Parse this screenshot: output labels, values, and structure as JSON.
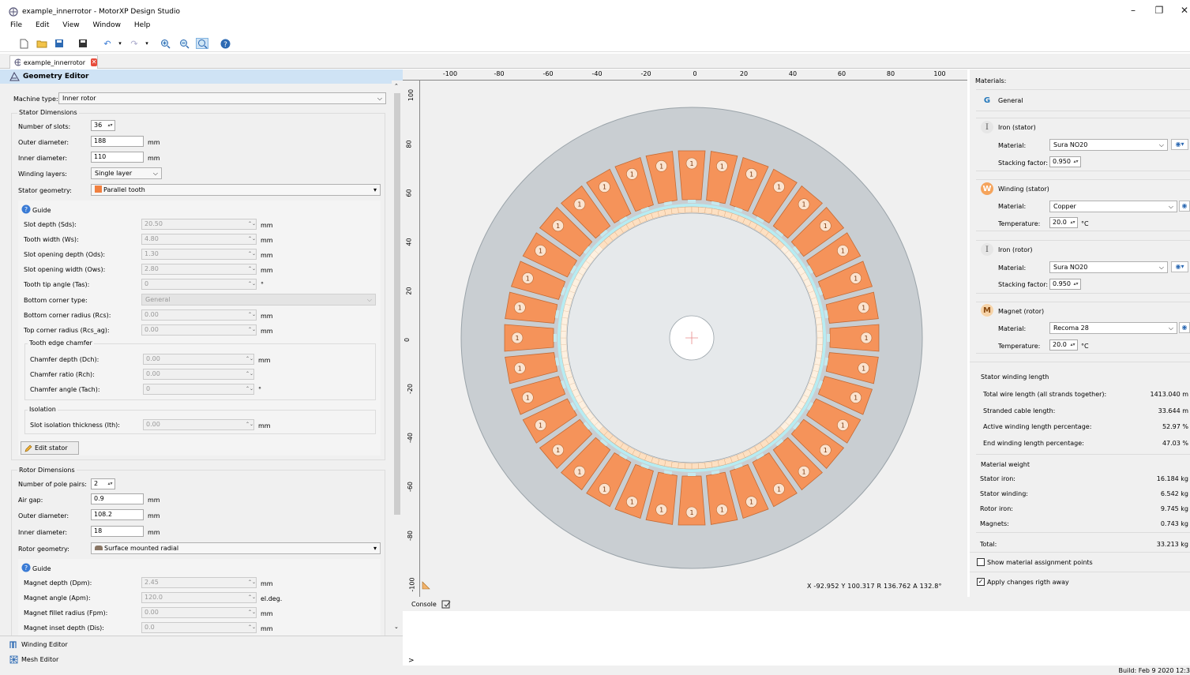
{
  "window": {
    "title": "example_innerrotor - MotorXP Design Studio"
  },
  "menu": [
    "File",
    "Edit",
    "View",
    "Window",
    "Help"
  ],
  "tab": {
    "label": "example_innerrotor"
  },
  "geometry_editor": {
    "header": "Geometry Editor",
    "machine_type_label": "Machine type:",
    "machine_type": "Inner rotor",
    "stator_dims_title": "Stator Dimensions",
    "stator": [
      {
        "label": "Number of slots:",
        "value": "36",
        "unit": ""
      },
      {
        "label": "Outer diameter:",
        "value": "188",
        "unit": "mm"
      },
      {
        "label": "Inner diameter:",
        "value": "110",
        "unit": "mm"
      }
    ],
    "winding_layers_label": "Winding layers:",
    "winding_layers": "Single layer",
    "stator_geometry_label": "Stator geometry:",
    "stator_geometry": "Parallel tooth",
    "guide": "Guide",
    "stator_params": [
      {
        "label": "Slot depth (Sds):",
        "value": "20.50",
        "unit": "mm"
      },
      {
        "label": "Tooth width (Ws):",
        "value": "4.80",
        "unit": "mm"
      },
      {
        "label": "Slot opening depth (Ods):",
        "value": "1.30",
        "unit": "mm"
      },
      {
        "label": "Slot opening width (Ows):",
        "value": "2.80",
        "unit": "mm"
      },
      {
        "label": "Tooth tip angle (Tas):",
        "value": "0",
        "unit": "°"
      }
    ],
    "bottom_corner_type_label": "Bottom corner type:",
    "bottom_corner_type": "General",
    "corner_params": [
      {
        "label": "Bottom corner radius (Rcs):",
        "value": "0.00",
        "unit": "mm"
      },
      {
        "label": "Top corner radius (Rcs_ag):",
        "value": "0.00",
        "unit": "mm"
      }
    ],
    "chamfer_title": "Tooth edge chamfer",
    "chamfer_params": [
      {
        "label": "Chamfer depth (Dch):",
        "value": "0.00",
        "unit": "mm"
      },
      {
        "label": "Chamfer ratio (Rch):",
        "value": "0.00",
        "unit": ""
      },
      {
        "label": "Chamfer angle (Tach):",
        "value": "0",
        "unit": "°"
      }
    ],
    "isolation_title": "Isolation",
    "isolation_param": {
      "label": "Slot isolation thickness (Ith):",
      "value": "0.00",
      "unit": "mm"
    },
    "edit_stator": "Edit stator",
    "rotor_dims_title": "Rotor Dimensions",
    "rotor": [
      {
        "label": "Number of pole pairs:",
        "value": "2",
        "unit": ""
      },
      {
        "label": "Air gap:",
        "value": "0.9",
        "unit": "mm"
      },
      {
        "label": "Outer diameter:",
        "value": "108.2",
        "unit": "mm"
      },
      {
        "label": "Inner diameter:",
        "value": "18",
        "unit": "mm"
      }
    ],
    "rotor_geometry_label": "Rotor geometry:",
    "rotor_geometry": "Surface mounted radial",
    "rotor_params": [
      {
        "label": "Magnet depth (Dpm):",
        "value": "2.45",
        "unit": "mm"
      },
      {
        "label": "Magnet angle (Apm):",
        "value": "120.0",
        "unit": "el.deg."
      },
      {
        "label": "Magnet fillet radius (Fpm):",
        "value": "0.00",
        "unit": "mm"
      },
      {
        "label": "Magnet inset depth (Dis):",
        "value": "0.0",
        "unit": "mm"
      }
    ]
  },
  "bottom_tabs": [
    "Winding Editor",
    "Mesh Editor"
  ],
  "ruler": {
    "x_ticks": [
      "-100",
      "-80",
      "-60",
      "-40",
      "-20",
      "0",
      "20",
      "40",
      "60",
      "80",
      "100"
    ],
    "y_ticks": [
      "100",
      "80",
      "60",
      "40",
      "20",
      "0",
      "-20",
      "-40",
      "-60",
      "-80",
      "-100"
    ]
  },
  "coords": "X -92.952   Y 100.317   R 136.762  A 132.8°",
  "slot_label": "1",
  "console": {
    "label": "Console",
    "prompt": ">"
  },
  "materials": {
    "title": "Materials:",
    "general": {
      "letter": "G",
      "name": "General"
    },
    "iron_stator": {
      "letter": "I",
      "name": "Iron (stator)",
      "material_label": "Material:",
      "material": "Sura NO20",
      "stacking_label": "Stacking factor:",
      "stacking": "0.950"
    },
    "winding": {
      "letter": "W",
      "name": "Winding (stator)",
      "material_label": "Material:",
      "material": "Copper",
      "temp_label": "Temperature:",
      "temp": "20.0",
      "temp_unit": "°C"
    },
    "iron_rotor": {
      "letter": "I",
      "name": "Iron (rotor)",
      "material_label": "Material:",
      "material": "Sura NO20",
      "stacking_label": "Stacking factor:",
      "stacking": "0.950"
    },
    "magnet": {
      "letter": "M",
      "name": "Magnet (rotor)",
      "material_label": "Material:",
      "material": "Recoma 28",
      "temp_label": "Temperature:",
      "temp": "20.0",
      "temp_unit": "°C"
    }
  },
  "winding_length": {
    "title": "Stator winding length",
    "rows": [
      {
        "label": "Total wire length (all strands together):",
        "value": "1413.040  m"
      },
      {
        "label": "Stranded cable length:",
        "value": "33.644  m"
      },
      {
        "label": "Active winding length percentage:",
        "value": "52.97  %"
      },
      {
        "label": "End winding length percentage:",
        "value": "47.03  %"
      }
    ]
  },
  "material_weight": {
    "title": "Material weight",
    "rows": [
      {
        "label": "Stator iron:",
        "value": "16.184  kg"
      },
      {
        "label": "Stator winding:",
        "value": "6.542  kg"
      },
      {
        "label": "Rotor iron:",
        "value": "9.745  kg"
      },
      {
        "label": "Magnets:",
        "value": "0.743  kg"
      }
    ],
    "total_label": "Total:",
    "total": "33.213  kg"
  },
  "options": {
    "show_points": "Show material assignment points",
    "apply": "Apply changes rigth away"
  },
  "status": {
    "build": "Build: Feb  9 2020 12:3"
  },
  "colors": {
    "accent": "#cfe3f5",
    "stator_iron": "#c9ced2",
    "slot": "#f5935a",
    "rotor": "#e6e9eb",
    "airgap": "#b7ecf2"
  }
}
